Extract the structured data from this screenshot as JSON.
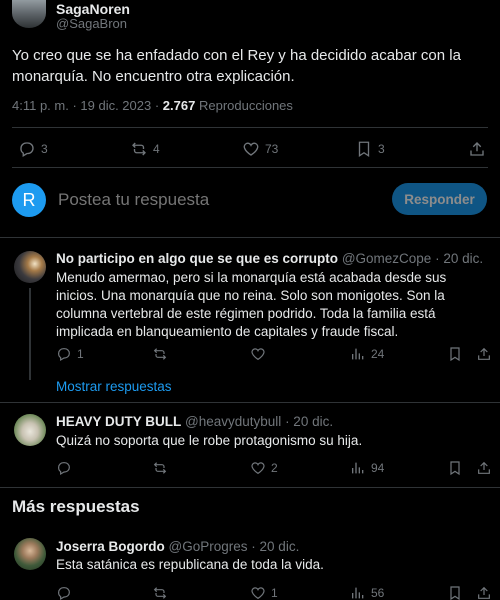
{
  "main_tweet": {
    "author_name": "SagaNoren",
    "author_handle": "@SagaBron",
    "text": "Yo creo que se ha enfadado con el Rey y ha decidido acabar con la monarquía. No encuentro otra explicación.",
    "time": "4:11 p. m. · 19 dic. 2023 ·",
    "views_count": "2.767",
    "views_label": "Reproducciones",
    "replies": "3",
    "reposts": "4",
    "likes": "73",
    "bookmarks": "3"
  },
  "composer": {
    "avatar_letter": "R",
    "placeholder": "Postea tu respuesta",
    "button_label": "Responder"
  },
  "replies": [
    {
      "author_name": "No participo en algo que se que es corrupto",
      "author_handle": "@GomezCope",
      "date": "· 20 dic.",
      "text": "Menudo amermao, pero si la monarquía está acabada desde sus inicios. Una monarquía que no reina. Solo son monigotes. Son la columna vertebral de este régimen podrido. Toda la familia está implicada en blanqueamiento de capitales y fraude fiscal.",
      "replies": "1",
      "reposts": "",
      "likes": "",
      "views": "24",
      "show_replies": "Mostrar respuestas"
    },
    {
      "author_name": "HEAVY DUTY BULL",
      "author_handle": "@heavydutybull",
      "date": "· 20 dic.",
      "text": "Quizá no soporta que le robe protagonismo su hija.",
      "replies": "",
      "reposts": "",
      "likes": "2",
      "views": "94"
    }
  ],
  "more_replies_heading": "Más respuestas",
  "more_replies": [
    {
      "author_name": "Joserra Bogordo",
      "author_handle": "@GoProgres",
      "date": "· 20 dic.",
      "text": "Esta satánica es republicana de toda la vida.",
      "replies": "",
      "reposts": "",
      "likes": "1",
      "views": "56"
    }
  ],
  "colors": {
    "background": "#000000",
    "text": "#e7e9ea",
    "muted": "#71767b",
    "divider": "#2f3336",
    "composer_avatar": "#1d9bf0",
    "button_bg": "#1d9bf0"
  }
}
